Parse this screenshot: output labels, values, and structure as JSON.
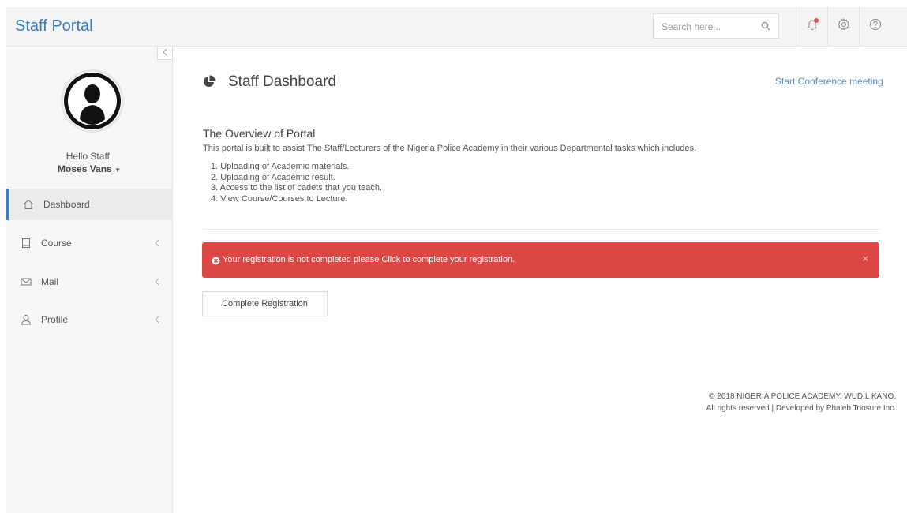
{
  "header": {
    "brand": "Staff Portal",
    "search_placeholder": "Search here...",
    "icons": [
      "search-icon",
      "bell-icon",
      "gear-icon",
      "help-icon"
    ]
  },
  "sidebar": {
    "greeting": "Hello Staff,",
    "user_name": "Moses Vans",
    "items": [
      {
        "label": "Dashboard",
        "icon": "home-icon",
        "active": true
      },
      {
        "label": "Course",
        "icon": "book-icon",
        "has_submenu": true
      },
      {
        "label": "Mail",
        "icon": "mail-icon",
        "has_submenu": true
      },
      {
        "label": "Profile",
        "icon": "user-icon",
        "has_submenu": true
      }
    ]
  },
  "main": {
    "title": "Staff Dashboard",
    "conference_link": "Start Conference meeting",
    "overview_heading": "The Overview of Portal",
    "intro": "This portal is built to assist The Staff/Lecturers of the Nigeria Police Academy in their various Departmental tasks which includes.",
    "tasks": [
      "1. Uploading of Academic materials.",
      "2. Uploading of Academic result.",
      "3. Access to the list of cadets that you teach.",
      "4. View Course/Courses to Lecture."
    ],
    "alert_text": "Your registration is not completed please Click to complete your registration.",
    "alert_close": "×",
    "complete_button": "Complete Registration"
  },
  "footer": {
    "line1": "© 2018 NIGERIA POLICE ACADEMY, WUDIL KANO.",
    "line2": "All rights reserved | Developed by Phaleb Toosure Inc."
  },
  "colors": {
    "brand": "#3c7cbf",
    "alert": "#da4744",
    "notification_dot": "#d9534f"
  }
}
